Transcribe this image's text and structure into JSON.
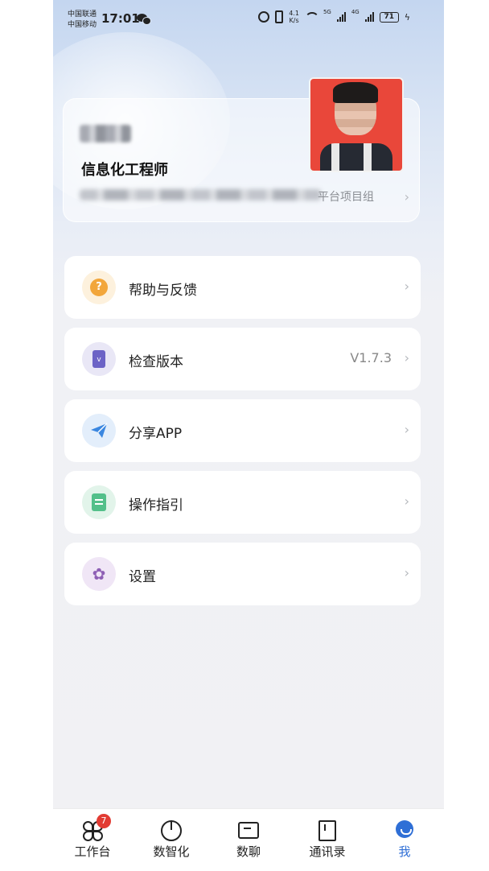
{
  "status_bar": {
    "carrier_1": "中国联通",
    "carrier_2": "中国移动",
    "time": "17:01",
    "net_speed_value": "4.1",
    "net_speed_unit": "K/s",
    "signal_1_tag": "5G",
    "signal_2_tag": "4G",
    "battery": "71"
  },
  "profile": {
    "role": "信息化工程师",
    "org_suffix": "平台项目组"
  },
  "menu": [
    {
      "label": "帮助与反馈",
      "value": "",
      "icon": "help-icon"
    },
    {
      "label": "检查版本",
      "value": "V1.7.3",
      "icon": "version-icon"
    },
    {
      "label": "分享APP",
      "value": "",
      "icon": "share-icon"
    },
    {
      "label": "操作指引",
      "value": "",
      "icon": "guide-icon"
    },
    {
      "label": "设置",
      "value": "",
      "icon": "settings-icon"
    }
  ],
  "tabbar": {
    "tabs": [
      {
        "label": "工作台",
        "icon": "workbench-icon",
        "badge": "7"
      },
      {
        "label": "数智化",
        "icon": "pie-chart-icon",
        "badge": ""
      },
      {
        "label": "数聊",
        "icon": "chat-icon",
        "badge": ""
      },
      {
        "label": "通讯录",
        "icon": "contacts-icon",
        "badge": ""
      },
      {
        "label": "我",
        "icon": "me-icon",
        "badge": ""
      }
    ],
    "active_color": "#2f6fd6"
  }
}
